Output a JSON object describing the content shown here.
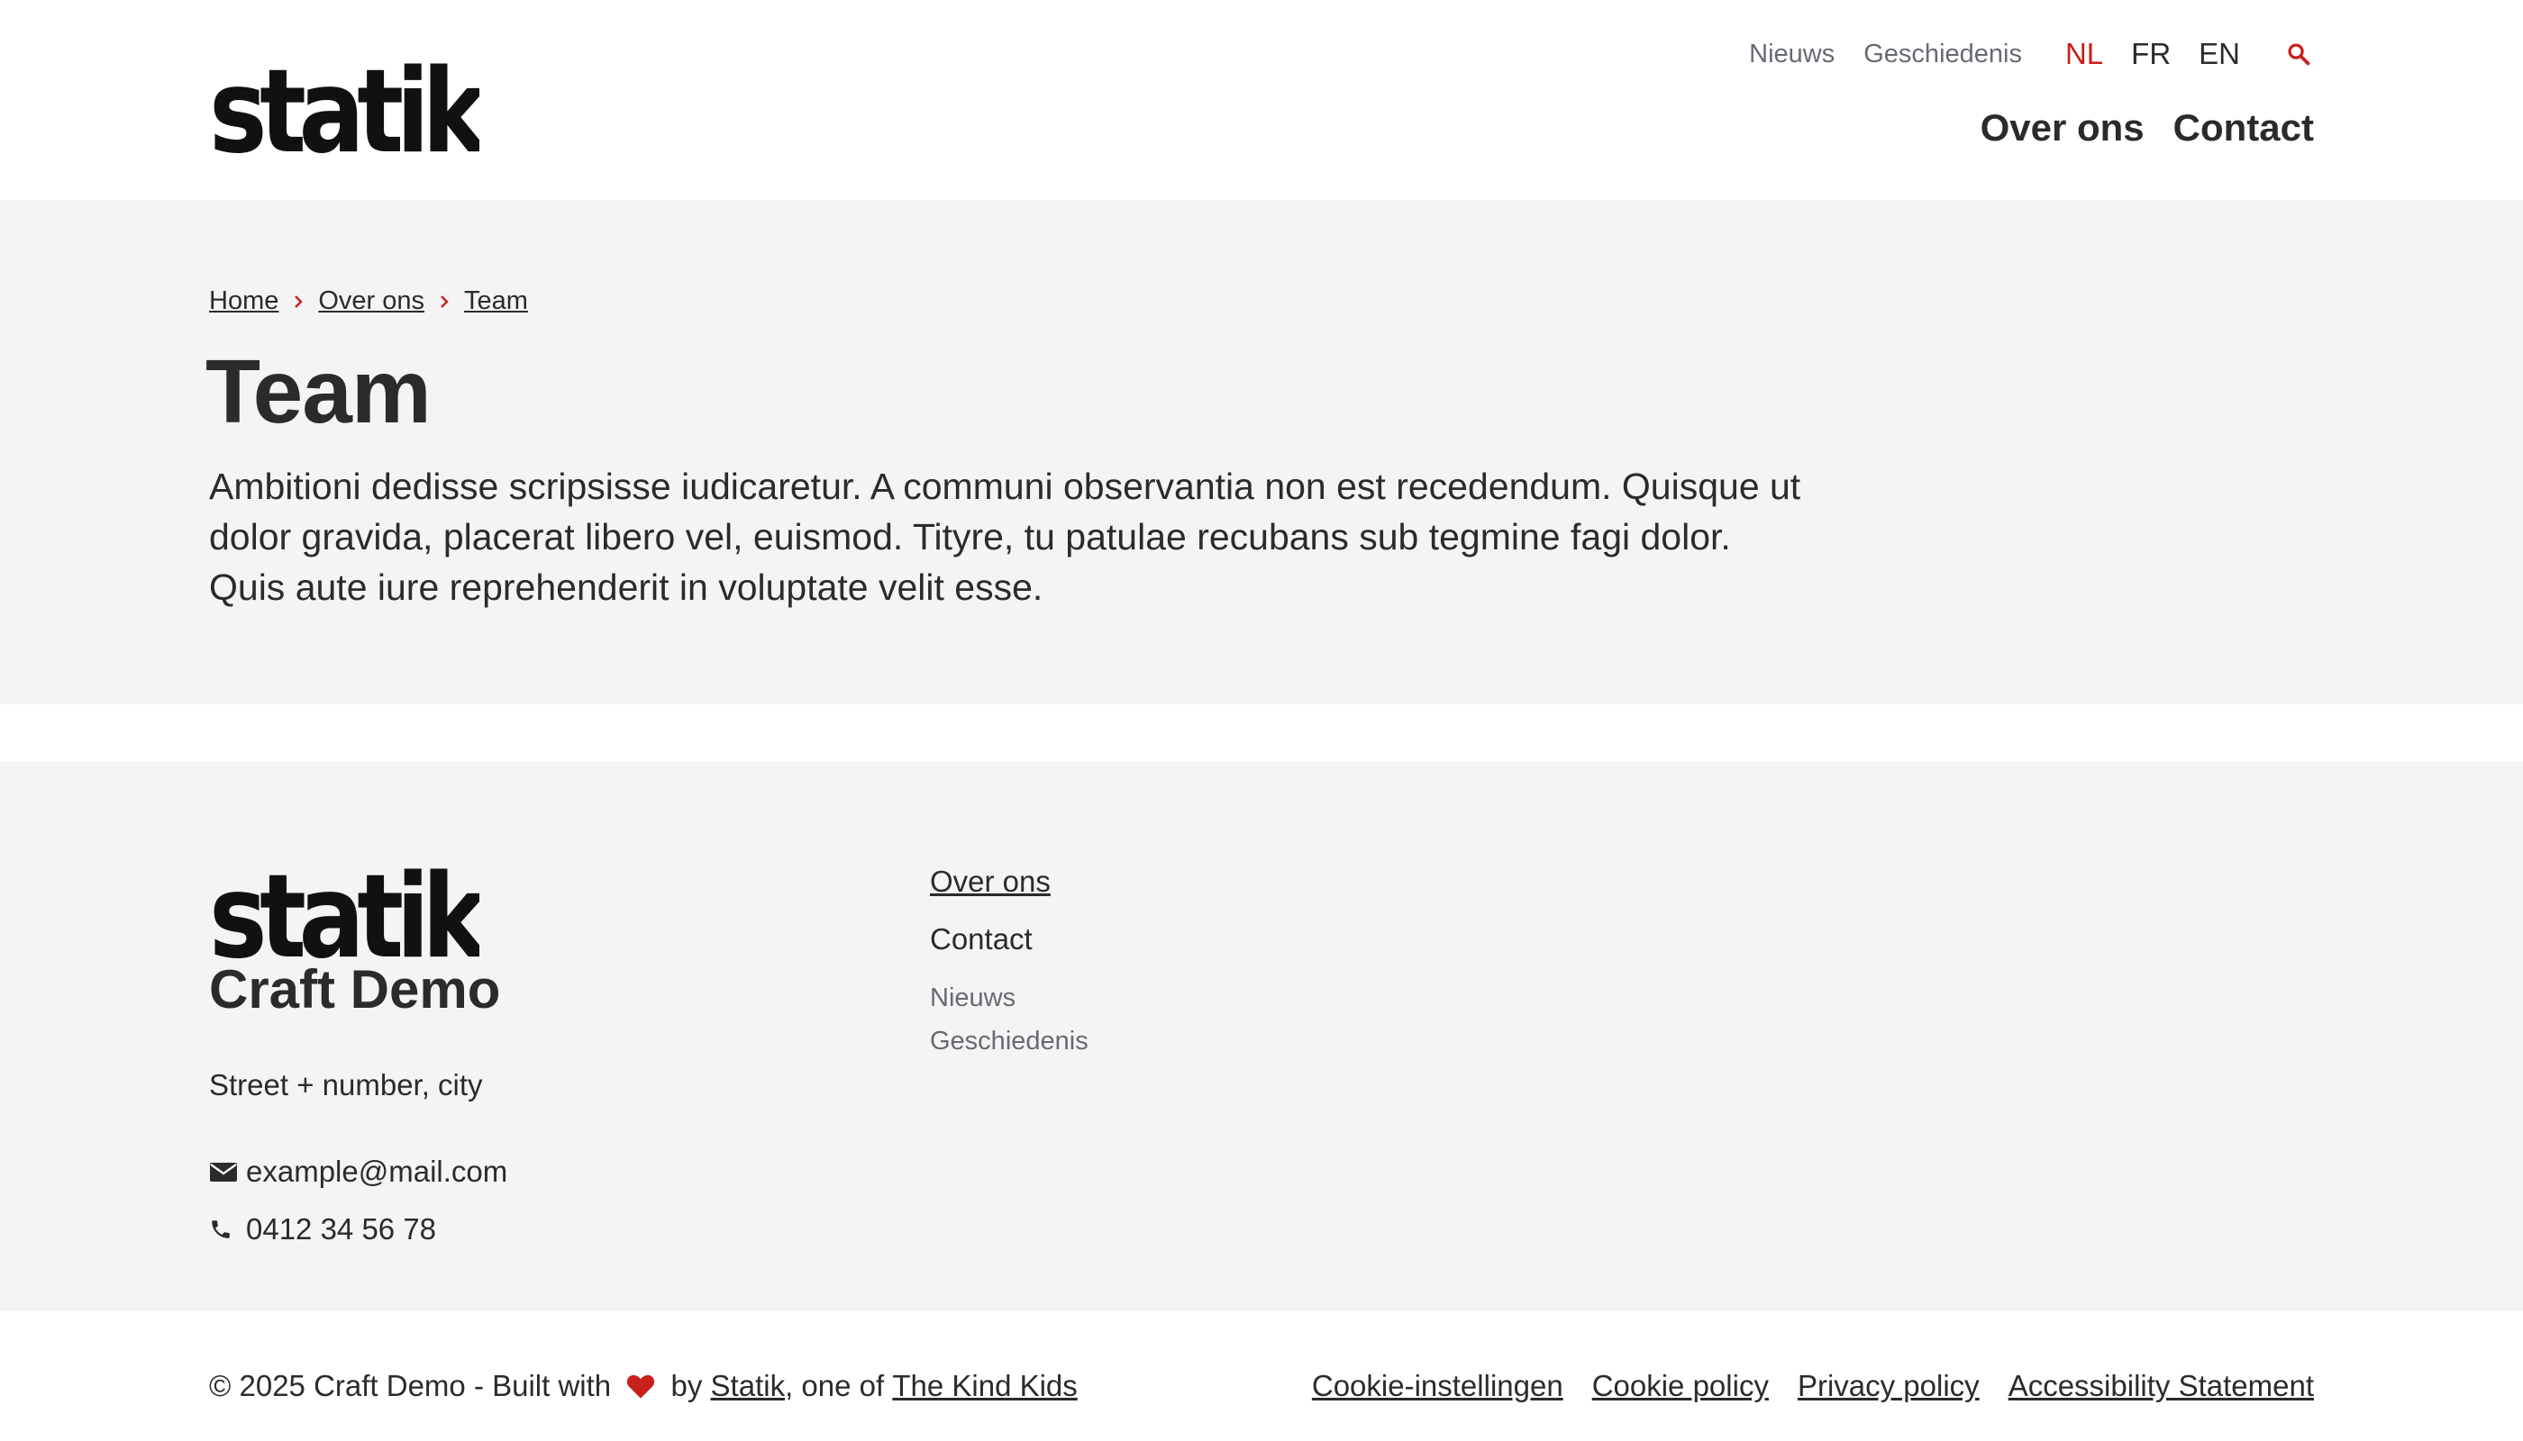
{
  "brand": {
    "logo_text": "statik",
    "accent": "#c8201b"
  },
  "header": {
    "utility_links": [
      "Nieuws",
      "Geschiedenis"
    ],
    "languages": [
      {
        "label": "NL",
        "active": true
      },
      {
        "label": "FR",
        "active": false
      },
      {
        "label": "EN",
        "active": false
      }
    ],
    "search_icon": "search-icon",
    "main_nav": [
      "Over ons",
      "Contact"
    ]
  },
  "hero": {
    "breadcrumb": [
      "Home",
      "Over ons",
      "Team"
    ],
    "title": "Team",
    "intro": "Ambitioni dedisse scripsisse iudicaretur. A communi observantia non est recedendum. Quisque ut dolor gravida, placerat libero vel, euismod. Tityre, tu patulae recubans sub tegmine fagi dolor. Quis aute iure reprehenderit in voluptate velit esse."
  },
  "footer": {
    "site_name": "Craft Demo",
    "address": "Street + number, city",
    "email": "example@mail.com",
    "phone": "0412 34 56 78",
    "nav_primary": [
      "Over ons",
      "Contact"
    ],
    "nav_secondary": [
      "Nieuws",
      "Geschiedenis"
    ]
  },
  "bottom": {
    "copyright_prefix": "© 2025 Craft Demo - Built with ",
    "by": " by ",
    "statik_link": "Statik",
    "one_of": ", one of ",
    "kind_kids_link": "The Kind Kids",
    "legal_links": [
      "Cookie-instellingen",
      "Cookie policy",
      "Privacy policy",
      "Accessibility Statement"
    ]
  }
}
